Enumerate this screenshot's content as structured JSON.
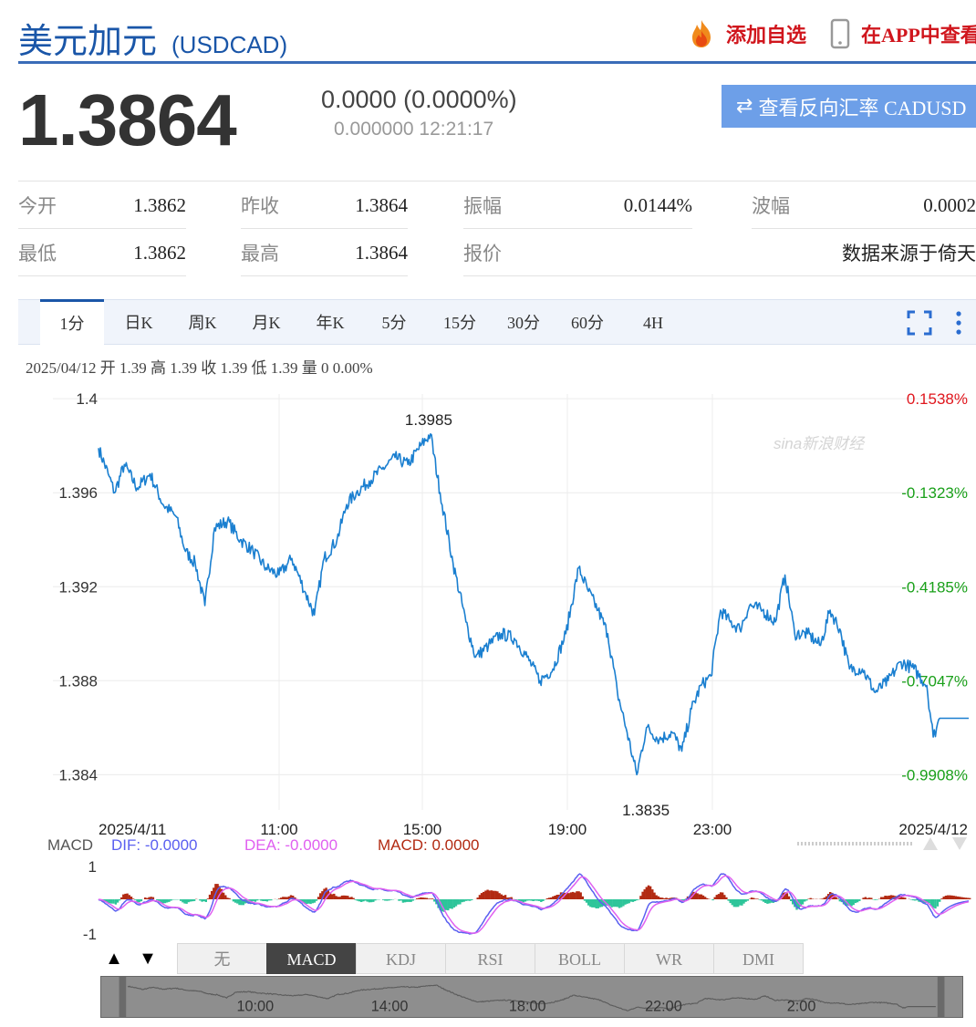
{
  "header": {
    "title": "美元加元",
    "code": "(USDCAD)",
    "add_watch": "添加自选",
    "app_view": "在APP中查看"
  },
  "quote": {
    "price": "1.3864",
    "change": "0.0000 (0.0000%)",
    "subline": "0.000000 12:21:17",
    "reverse_button": "查看反向汇率 CADUSD"
  },
  "stats": [
    {
      "label": "今开",
      "value": "1.3862"
    },
    {
      "label": "昨收",
      "value": "1.3864"
    },
    {
      "label": "振幅",
      "value": "0.0144%"
    },
    {
      "label": "波幅",
      "value": "0.0002"
    },
    {
      "label": "最低",
      "value": "1.3862"
    },
    {
      "label": "最高",
      "value": "1.3864"
    },
    {
      "label": "报价",
      "value": ""
    },
    {
      "label": "",
      "value": "数据来源于倚天"
    }
  ],
  "tabs": [
    "1分",
    "日K",
    "周K",
    "月K",
    "年K",
    "5分",
    "15分",
    "30分",
    "60分",
    "4H"
  ],
  "active_tab": "1分",
  "ohlc_line": "2025/04/12 开 1.39 高 1.39 收 1.39 低 1.39 量 0 0.00%",
  "watermark": "sina新浪财经",
  "indicator_tabs": [
    "无",
    "MACD",
    "KDJ",
    "RSI",
    "BOLL",
    "WR",
    "DMI"
  ],
  "active_indicator": "MACD",
  "colors": {
    "brand": "#1a56a8",
    "line": "#1a7fd0",
    "up": "#e0161d",
    "down": "#1aa01a",
    "macd_up": "#b22a12",
    "macd_down": "#2ec59a",
    "dif": "#5a5ff0",
    "dea": "#e060f0"
  },
  "chart_data": {
    "type": "line",
    "series_name": "",
    "y_ticks": [
      "1.4",
      "1.396",
      "1.392",
      "1.388",
      "1.384"
    ],
    "y_tick_values": [
      1.4,
      1.396,
      1.392,
      1.388,
      1.384
    ],
    "right_ticks": [
      "0.1538%",
      "-0.1323%",
      "-0.4185%",
      "-0.7047%",
      "-0.9908%"
    ],
    "x_ticks": [
      "2025/4/11",
      "11:00",
      "15:00",
      "19:00",
      "23:00",
      "2025/4/12"
    ],
    "ylim": [
      1.3825,
      1.4002
    ],
    "max_label": "1.3985",
    "min_label": "1.3835",
    "keypoints": [
      [
        0,
        1.3979
      ],
      [
        3,
        1.3968
      ],
      [
        5,
        1.396
      ],
      [
        8,
        1.3972
      ],
      [
        12,
        1.3962
      ],
      [
        16,
        1.3968
      ],
      [
        20,
        1.3955
      ],
      [
        24,
        1.395
      ],
      [
        27,
        1.3935
      ],
      [
        30,
        1.393
      ],
      [
        33,
        1.3912
      ],
      [
        36,
        1.3945
      ],
      [
        40,
        1.3948
      ],
      [
        44,
        1.394
      ],
      [
        48,
        1.3935
      ],
      [
        52,
        1.3928
      ],
      [
        56,
        1.3925
      ],
      [
        60,
        1.3932
      ],
      [
        64,
        1.3918
      ],
      [
        67,
        1.3908
      ],
      [
        70,
        1.3932
      ],
      [
        74,
        1.394
      ],
      [
        77,
        1.3955
      ],
      [
        80,
        1.396
      ],
      [
        84,
        1.3965
      ],
      [
        88,
        1.397
      ],
      [
        92,
        1.3975
      ],
      [
        96,
        1.3972
      ],
      [
        100,
        1.398
      ],
      [
        103,
        1.3985
      ],
      [
        106,
        1.396
      ],
      [
        110,
        1.393
      ],
      [
        114,
        1.3905
      ],
      [
        117,
        1.389
      ],
      [
        121,
        1.3895
      ],
      [
        125,
        1.39
      ],
      [
        129,
        1.3898
      ],
      [
        133,
        1.389
      ],
      [
        137,
        1.388
      ],
      [
        141,
        1.3885
      ],
      [
        145,
        1.39
      ],
      [
        149,
        1.3928
      ],
      [
        152,
        1.3918
      ],
      [
        155,
        1.391
      ],
      [
        158,
        1.39
      ],
      [
        161,
        1.3875
      ],
      [
        164,
        1.3858
      ],
      [
        167,
        1.384
      ],
      [
        170,
        1.386
      ],
      [
        174,
        1.3855
      ],
      [
        178,
        1.3858
      ],
      [
        181,
        1.385
      ],
      [
        184,
        1.3868
      ],
      [
        187,
        1.3878
      ],
      [
        190,
        1.3882
      ],
      [
        193,
        1.391
      ],
      [
        196,
        1.3905
      ],
      [
        199,
        1.3902
      ],
      [
        202,
        1.3912
      ],
      [
        206,
        1.391
      ],
      [
        210,
        1.3905
      ],
      [
        213,
        1.3925
      ],
      [
        216,
        1.39
      ],
      [
        220,
        1.39
      ],
      [
        224,
        1.3895
      ],
      [
        227,
        1.391
      ],
      [
        230,
        1.3902
      ],
      [
        233,
        1.3885
      ],
      [
        237,
        1.3885
      ],
      [
        241,
        1.3875
      ],
      [
        245,
        1.388
      ],
      [
        249,
        1.3888
      ],
      [
        253,
        1.3885
      ],
      [
        257,
        1.3878
      ],
      [
        259,
        1.3856
      ],
      [
        261,
        1.3864
      ],
      [
        270,
        1.3864
      ]
    ],
    "macd": {
      "label": "MACD",
      "dif_label": "DIF: -0.0000",
      "dea_label": "DEA: -0.0000",
      "macd_label": "MACD: 0.0000",
      "y_ticks": [
        "1",
        "-1"
      ],
      "ylim": [
        -1.3,
        1.3
      ]
    },
    "navigator_ticks": [
      "10:00",
      "14:00",
      "18:00",
      "22:00",
      "2:00"
    ]
  }
}
